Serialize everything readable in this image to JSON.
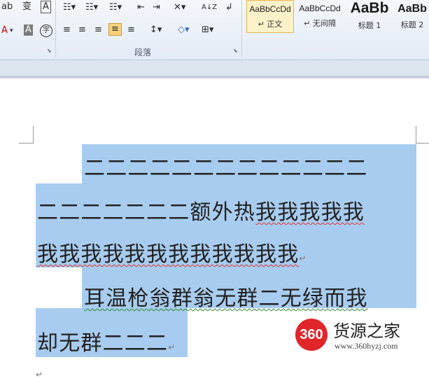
{
  "ribbon": {
    "font_row1": [
      "ab",
      "变",
      "A"
    ],
    "font_row2": [
      "A",
      "A",
      "字"
    ],
    "paragraph_label": "段落",
    "para_row1": [
      "☷▾",
      "☷▾",
      "☷▾",
      "⇤",
      "⇥",
      "✕▾",
      "A↓Z",
      "↲"
    ],
    "para_row2": [
      "≡",
      "≡",
      "≡",
      "≡",
      "≡",
      "↕▾",
      "◇▾",
      "⊞▾"
    ],
    "styles": [
      {
        "sample": "AaBbCcDd",
        "name": "↵ 正文"
      },
      {
        "sample": "AaBbCcDd",
        "name": "↵ 无间隔"
      },
      {
        "sample": "AaBb",
        "name": "标题 1"
      },
      {
        "sample": "AaBb",
        "name": "标题 2"
      }
    ]
  },
  "document": {
    "line1": "二二二二二二二二二二二二二",
    "line2_plain": "二二二二二二二额外热",
    "line2_squig": "我我我我我",
    "line3": "我我我我我我我我我我我我",
    "line4": "耳温枪翁群翁无群二无绿而我",
    "line5": "却无群二二二",
    "mark": "↵"
  },
  "watermark": {
    "logo": "360",
    "title": "货源之家",
    "url": "www.360hyzj.com"
  }
}
